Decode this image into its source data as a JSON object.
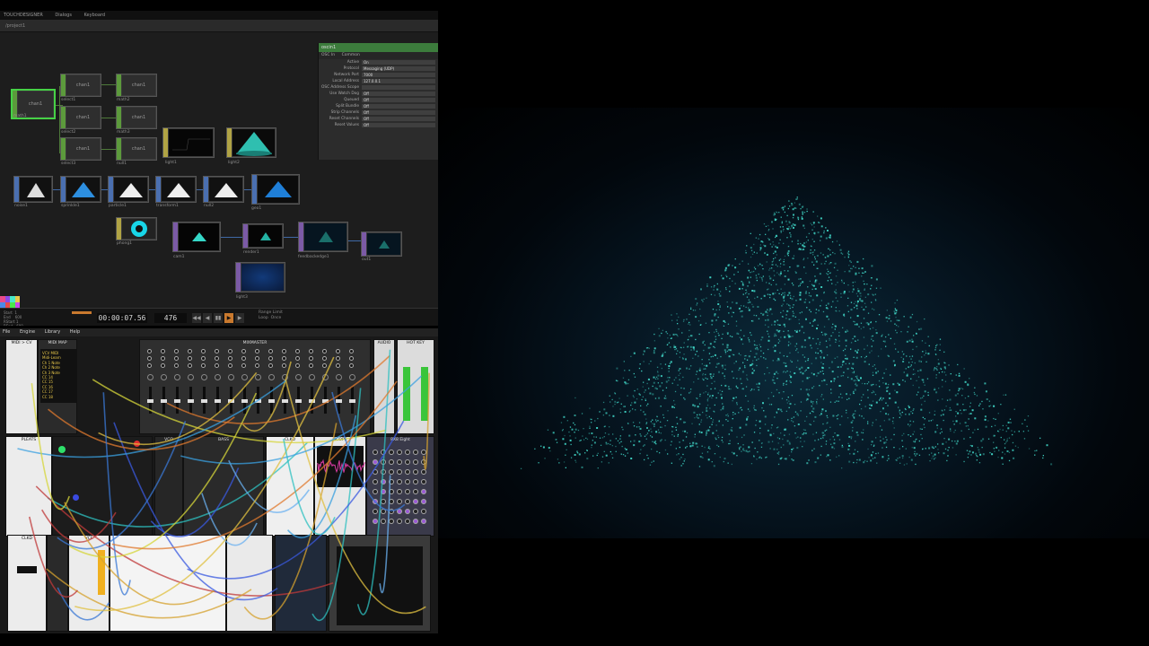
{
  "touchdesigner": {
    "titlebar": [
      "TOUCHDESIGNER",
      "Dialogs",
      "Keyboard"
    ],
    "path": "/project1",
    "nodes": [
      {
        "id": "select1",
        "label": "select1",
        "thumb": "chan1"
      },
      {
        "id": "select2",
        "label": "select2",
        "thumb": "chan1"
      },
      {
        "id": "select3",
        "label": "select3",
        "thumb": "chan1"
      },
      {
        "id": "math1",
        "label": "math1",
        "thumb": "chan1"
      },
      {
        "id": "math2",
        "label": "math2",
        "thumb": "chan1"
      },
      {
        "id": "math3",
        "label": "math3",
        "thumb": "chan1"
      },
      {
        "id": "lfo1",
        "label": "lfo1",
        "thumb": "chan1"
      },
      {
        "id": "null1",
        "label": "null1",
        "thumb": "chan1"
      },
      {
        "id": "light1",
        "label": "light1",
        "thumb": ""
      },
      {
        "id": "light2",
        "label": "light2",
        "thumb": ""
      },
      {
        "id": "noise1",
        "label": "noise1",
        "thumb": ""
      },
      {
        "id": "sprinkle1",
        "label": "sprinkle1",
        "thumb": ""
      },
      {
        "id": "particle1",
        "label": "particle1",
        "thumb": ""
      },
      {
        "id": "transform1",
        "label": "transform1",
        "thumb": ""
      },
      {
        "id": "null2",
        "label": "null2",
        "thumb": ""
      },
      {
        "id": "geo1",
        "label": "geo1",
        "thumb": ""
      },
      {
        "id": "phong1",
        "label": "phong1",
        "thumb": ""
      },
      {
        "id": "cam1",
        "label": "cam1",
        "thumb": ""
      },
      {
        "id": "render1",
        "label": "render1",
        "thumb": ""
      },
      {
        "id": "feedbackedge1",
        "label": "feedbackedge1",
        "thumb": ""
      },
      {
        "id": "out1",
        "label": "out1",
        "thumb": ""
      },
      {
        "id": "light3",
        "label": "light3",
        "thumb": ""
      }
    ],
    "params": {
      "header": "oscin1",
      "tabs": [
        "OSC In",
        "Common"
      ],
      "rows": [
        {
          "label": "Active",
          "value": "On"
        },
        {
          "label": "Protocol",
          "value": "Messaging (UDP)"
        },
        {
          "label": "Network Port",
          "value": "7000"
        },
        {
          "label": "Local Address",
          "value": "127.0.0.1"
        },
        {
          "label": "OSC Address Scope",
          "value": ""
        },
        {
          "label": "Use Watch Dog",
          "value": "Off"
        },
        {
          "label": "Queued",
          "value": "Off"
        },
        {
          "label": "Split Bundle",
          "value": "Off"
        },
        {
          "label": "Strip Channels",
          "value": "Off"
        },
        {
          "label": "Reset Channels",
          "value": "Off"
        },
        {
          "label": "Reset Values",
          "value": "Off"
        }
      ]
    },
    "timeline": {
      "time": "00:00:07.56",
      "frame": "476",
      "stats": "Start  1\nEnd    600\nRStart 1\nREnd   600",
      "range_label": "Range Limit\nLoop  Once"
    }
  },
  "vcv": {
    "menubar": [
      "File",
      "Engine",
      "Library",
      "Help"
    ],
    "modules": {
      "midi_cv": "MIDI > CV",
      "midi_map": "MIDI MAP",
      "mixer": "MIXMASTER",
      "audio": "AUDIO",
      "scope": "SCOPE",
      "hotkey": "HOT KEY",
      "clocked": "CLKD",
      "vcf": "VCF",
      "vco": "VCO",
      "bass": "BASS",
      "eight": "8X8 Eight",
      "pleats": "PLEATS"
    },
    "midi_display": "VCV MIDI\nMidi-Learn\nCh 1 Note\nCh 2 Note\nCh 3 Note\nCC 14\nCC 15\nCC 16\nCC 17\nCC 18"
  },
  "render": {
    "particle_color": "#3fd3c4",
    "particle_count": 2600,
    "shape": "pyramid"
  },
  "colors": {
    "chop": "#5c9a3c",
    "sop": "#4a6fb0",
    "top": "#7b5aa6",
    "mat": "#b0a344",
    "accent": "#c9792e"
  }
}
